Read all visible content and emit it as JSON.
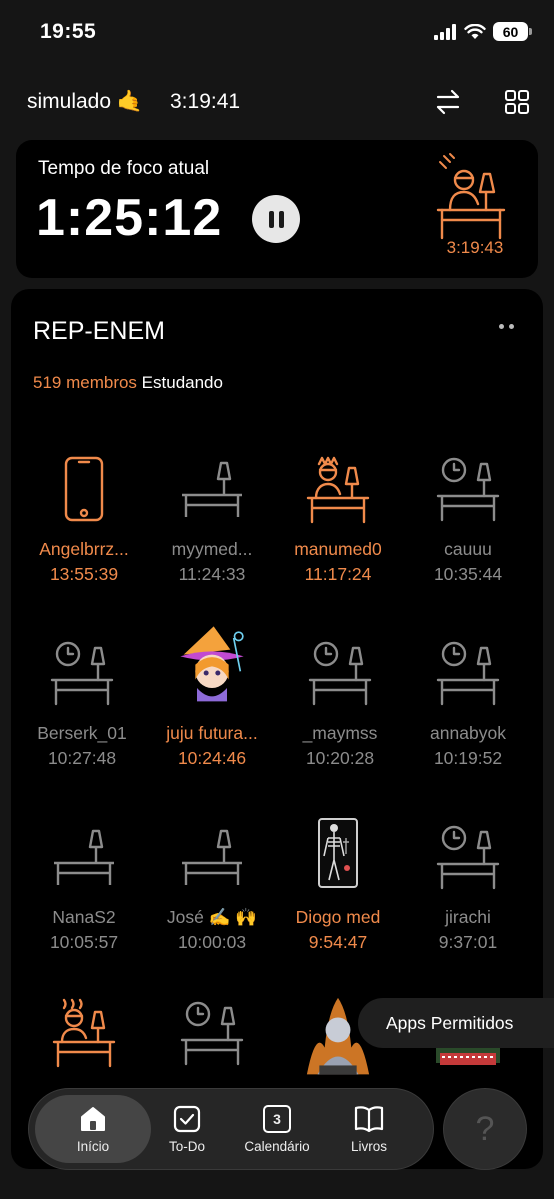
{
  "status_bar": {
    "time": "19:55",
    "battery": "60"
  },
  "header": {
    "title": "simulado 🤙",
    "timer": "3:19:41"
  },
  "focus_card": {
    "label": "Tempo de foco atual",
    "time": "1:25:12",
    "avatar_time": "3:19:43"
  },
  "group": {
    "name": "REP-ENEM",
    "members_count": "519 membros",
    "status_text": "Estudando",
    "members": [
      {
        "name": "Angelbrrz...",
        "time": "13:55:39",
        "state": "active",
        "icon": "phone-icon"
      },
      {
        "name": "myymed...",
        "time": "11:24:33",
        "state": "idle",
        "icon": "desk-lamp-icon"
      },
      {
        "name": "manumed0",
        "time": "11:17:24",
        "state": "active",
        "icon": "studying-person-icon"
      },
      {
        "name": "cauuu",
        "time": "10:35:44",
        "state": "idle",
        "icon": "desk-clock-icon"
      },
      {
        "name": "Berserk_01",
        "time": "10:27:48",
        "state": "idle",
        "icon": "desk-clock-icon"
      },
      {
        "name": "juju futura...",
        "time": "10:24:46",
        "state": "active",
        "icon": "witch-avatar-icon"
      },
      {
        "name": "_maymss",
        "time": "10:20:28",
        "state": "idle",
        "icon": "desk-clock-icon"
      },
      {
        "name": "annabyok",
        "time": "10:19:52",
        "state": "idle",
        "icon": "desk-clock-icon"
      },
      {
        "name": "NanaS2",
        "time": "10:05:57",
        "state": "idle",
        "icon": "desk-lamp-icon"
      },
      {
        "name": "José ✍️ 🙌",
        "time": "10:00:03",
        "state": "idle",
        "icon": "desk-lamp-icon"
      },
      {
        "name": "Diogo med",
        "time": "9:54:47",
        "state": "active",
        "icon": "skeleton-card-icon"
      },
      {
        "name": "jirachi",
        "time": "9:37:01",
        "state": "idle",
        "icon": "desk-clock-icon"
      }
    ]
  },
  "tooltip": "Apps Permitidos",
  "tabs": [
    {
      "label": "Início",
      "icon": "home-icon"
    },
    {
      "label": "To-Do",
      "icon": "checkbox-icon"
    },
    {
      "label": "Calendário",
      "icon": "calendar-icon",
      "badge": "3"
    },
    {
      "label": "Livros",
      "icon": "book-icon"
    }
  ],
  "help": "?",
  "colors": {
    "accent": "#f08a4b",
    "idle": "#8c8c8c",
    "card": "#000000",
    "background": "#151515"
  }
}
